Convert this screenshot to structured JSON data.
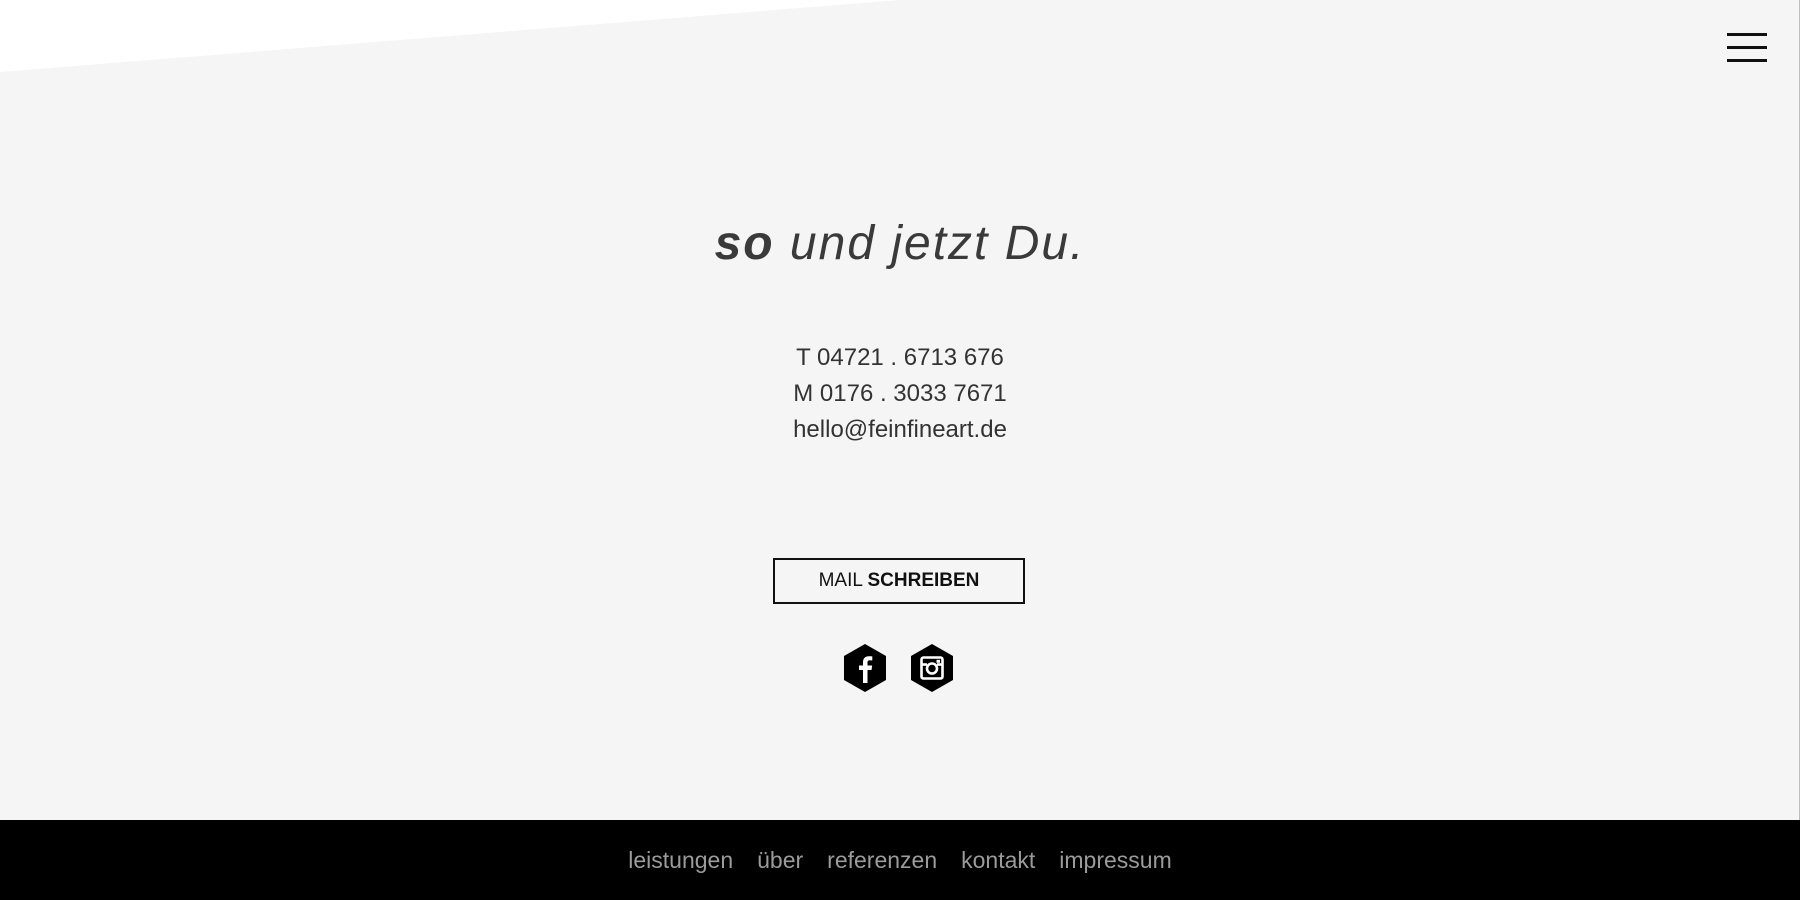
{
  "header": {
    "menu_icon": "hamburger-menu-icon"
  },
  "headline": {
    "strong": "so",
    "rest": " und jetzt Du."
  },
  "contact": {
    "phone": "T 04721 . 6713 676",
    "mobile": "M 0176 . 3033 7671",
    "email": "hello@feinfineart.de"
  },
  "cta": {
    "label_regular": "MAIL ",
    "label_bold": "SCHREIBEN"
  },
  "social": {
    "facebook_icon": "facebook-icon",
    "instagram_icon": "instagram-icon",
    "icon_color": "#000000"
  },
  "footer": {
    "nav": [
      "leistungen",
      "über",
      "referenzen",
      "kontakt",
      "impressum"
    ]
  },
  "colors": {
    "page_background": "#f5f5f5",
    "footer_background": "#000000",
    "footer_link": "#9b9b9b",
    "text": "#333333"
  }
}
